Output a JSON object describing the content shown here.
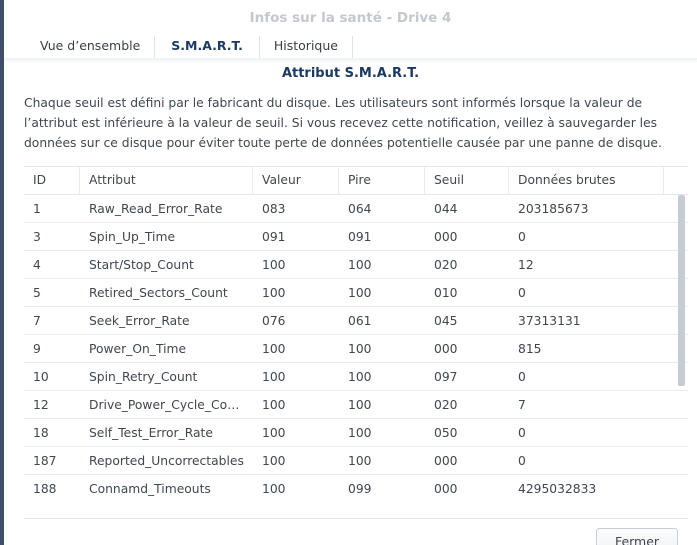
{
  "window": {
    "title": "Infos sur la santé - Drive 4"
  },
  "tabs": [
    {
      "label": "Vue d’ensemble",
      "active": false
    },
    {
      "label": "S.M.A.R.T.",
      "active": true
    },
    {
      "label": "Historique",
      "active": false
    }
  ],
  "section": {
    "title": "Attribut S.M.A.R.T.",
    "description": "Chaque seuil est défini par le fabricant du disque. Les utilisateurs sont informés lorsque la valeur de l’attribut est inférieure à la valeur de seuil. Si vous recevez cette notification, veillez à sauvegarder les données sur ce disque pour éviter toute perte de données potentielle causée par une panne de disque."
  },
  "table": {
    "columns": [
      "ID",
      "Attribut",
      "Valeur",
      "Pire",
      "Seuil",
      "Données brutes"
    ],
    "rows": [
      [
        "1",
        "Raw_Read_Error_Rate",
        "083",
        "064",
        "044",
        "203185673"
      ],
      [
        "3",
        "Spin_Up_Time",
        "091",
        "091",
        "000",
        "0"
      ],
      [
        "4",
        "Start/Stop_Count",
        "100",
        "100",
        "020",
        "12"
      ],
      [
        "5",
        "Retired_Sectors_Count",
        "100",
        "100",
        "010",
        "0"
      ],
      [
        "7",
        "Seek_Error_Rate",
        "076",
        "061",
        "045",
        "37313131"
      ],
      [
        "9",
        "Power_On_Time",
        "100",
        "100",
        "000",
        "815"
      ],
      [
        "10",
        "Spin_Retry_Count",
        "100",
        "100",
        "097",
        "0"
      ],
      [
        "12",
        "Drive_Power_Cycle_Co…",
        "100",
        "100",
        "020",
        "7"
      ],
      [
        "18",
        "Self_Test_Error_Rate",
        "100",
        "100",
        "050",
        "0"
      ],
      [
        "187",
        "Reported_Uncorrectables",
        "100",
        "100",
        "000",
        "0"
      ],
      [
        "188",
        "Connamd_Timeouts",
        "100",
        "099",
        "000",
        "4295032833"
      ]
    ]
  },
  "footer": {
    "close_label": "Fermer"
  }
}
